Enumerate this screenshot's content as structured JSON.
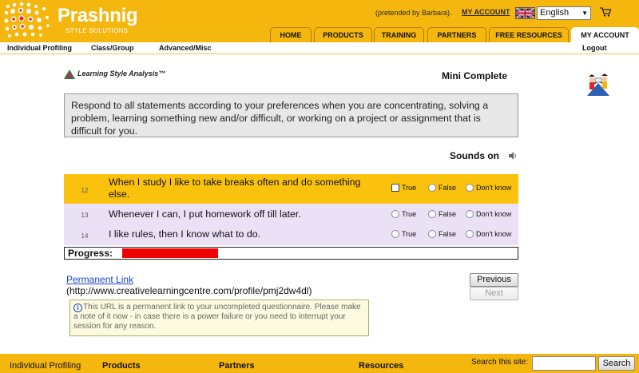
{
  "brand": {
    "name": "Prashnig",
    "tagline": "STYLE SOLUTIONS"
  },
  "header": {
    "pretended_text": "(pretended by Barbara).",
    "my_account_link": "MY ACCOUNT",
    "language": "English",
    "cart_icon": "shopping-cart-icon",
    "flag_icon": "uk-flag-icon"
  },
  "tabs": [
    {
      "label": "HOME",
      "active": false
    },
    {
      "label": "PRODUCTS",
      "active": false
    },
    {
      "label": "TRAINING",
      "active": false
    },
    {
      "label": "PARTNERS",
      "active": false
    },
    {
      "label": "FREE RESOURCES",
      "active": false
    },
    {
      "label": "MY ACCOUNT",
      "active": true
    }
  ],
  "subnav": {
    "items": [
      "Individual Profiling",
      "Class/Group",
      "Advanced/Misc"
    ],
    "logout": "Logout"
  },
  "main": {
    "product_logo": "Learning Style Analysis™",
    "mode_title": "Mini Complete",
    "instructions": "Respond to all statements according to your preferences when you are concentrating, solving a problem, learning something new and/or difficult, or working on a project or assignment that is difficult for you.",
    "sounds_label": "Sounds on",
    "options": [
      "True",
      "False",
      "Don't know"
    ],
    "questions": [
      {
        "number": "12",
        "text": "When I study I like to take breaks often and do something else.",
        "highlighted": true
      },
      {
        "number": "13",
        "text": "Whenever I can, I put homework off till later.",
        "highlighted": false
      },
      {
        "number": "14",
        "text": "I like rules, then I know what to do.",
        "highlighted": false
      }
    ],
    "progress_label": "Progress:",
    "progress_fraction": 0.245,
    "permanent_link_label": "Permanent Link",
    "permanent_link_url": "(http://www.creativelearningcentre.com/profile/pmj2dw4dl)",
    "permanent_note": "This URL is a permanent link to your uncompleted questionnaire. Please make a note of it now - in case there is a power failure or you need to interrupt your session for any reason.",
    "previous_button": "Previous",
    "next_button": "Next"
  },
  "footer": {
    "items": [
      "Individual Profiling",
      "Products",
      "Partners",
      "Resources"
    ],
    "search_label": "Search this site:",
    "search_button": "Search",
    "search_value": ""
  },
  "colors": {
    "brand_yellow": "#f5b70e",
    "highlight_row": "#fbc20d",
    "alt_row": "#ebe1f6",
    "progress_red": "#ee0000",
    "link_blue": "#1a44c8"
  }
}
